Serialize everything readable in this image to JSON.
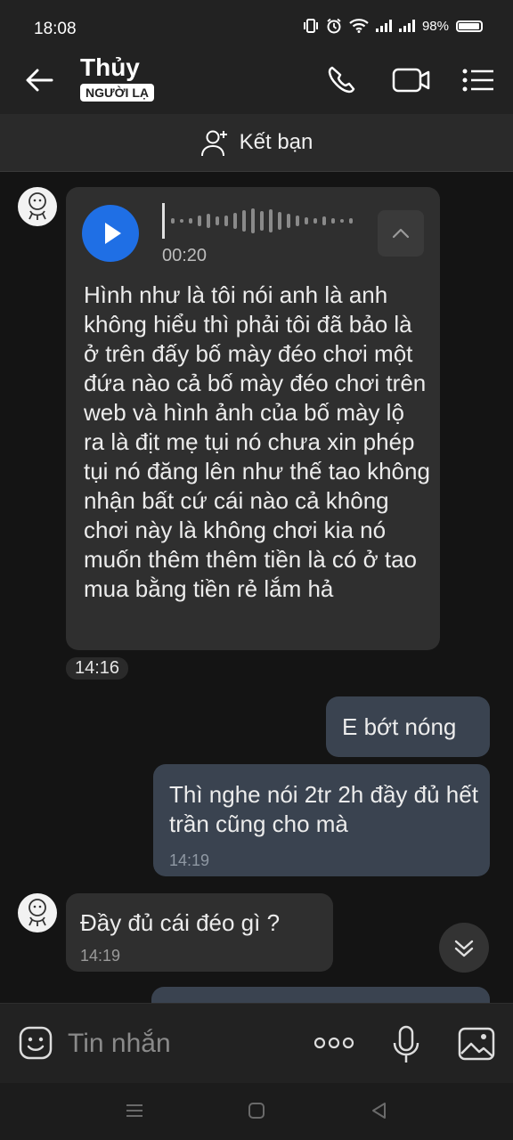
{
  "status_bar": {
    "time": "18:08",
    "battery": "98%"
  },
  "header": {
    "contact_name": "Thủy",
    "badge": "NGƯỜI LẠ"
  },
  "friend_bar": {
    "label": "Kết bạn"
  },
  "messages": {
    "voice": {
      "duration": "00:20",
      "transcript": "Hình như là tôi nói anh là anh không hiểu thì phải tôi đã bảo là ở trên đấy bố mày đéo chơi một đứa nào cả bố mày đéo chơi trên web và hình ảnh của bố mày lộ ra là địt mẹ tụi nó chưa xin phép tụi nó đăng lên như thế tao không nhận bất cứ cái nào cả không chơi này là không chơi kia nó muốn thêm thêm tiền là có ở tao mua bằng tiền rẻ lắm hả",
      "time": "14:16"
    },
    "out1": {
      "text": "E bớt nóng"
    },
    "out2": {
      "text": "Thì nghe nói 2tr 2h đầy đủ hết trần cũng cho mà",
      "time": "14:19"
    },
    "in2": {
      "text": "Đầy đủ cái đéo gì ?",
      "time": "14:19"
    }
  },
  "input_bar": {
    "placeholder": "Tin nhắn"
  },
  "colors": {
    "accent": "#1f6fe5",
    "bg": "#141414",
    "bubble_in": "#2f2f2f",
    "bubble_out": "#3a4350"
  }
}
